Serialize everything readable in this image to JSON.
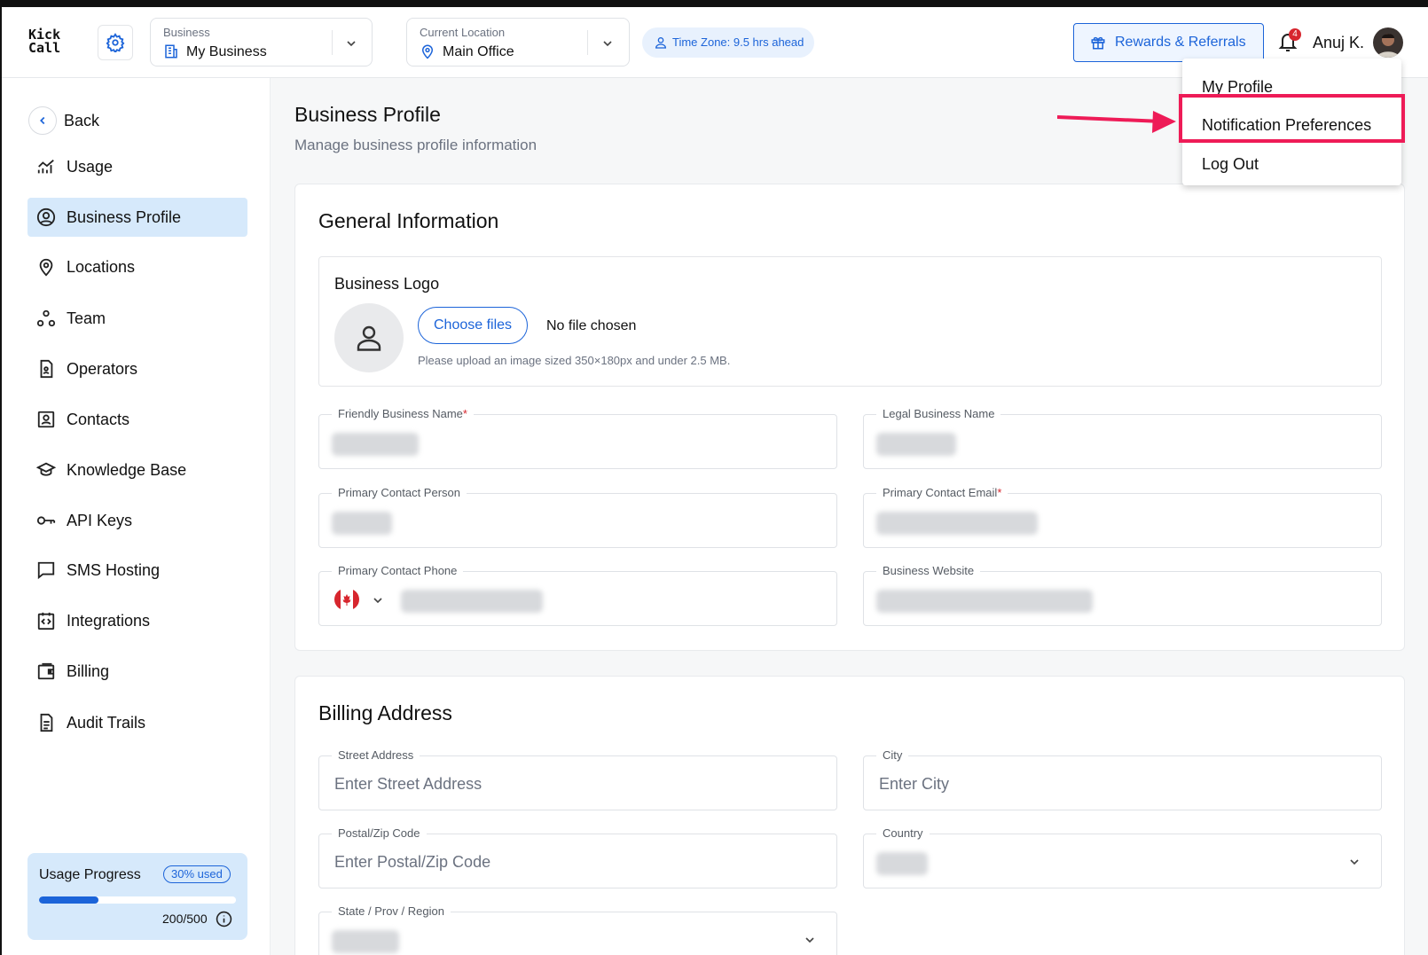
{
  "brand": {
    "logo_line1": "Kick",
    "logo_line2": "Call"
  },
  "header": {
    "business": {
      "caption": "Business",
      "value": "My Business"
    },
    "location": {
      "caption": "Current Location",
      "value": "Main Office"
    },
    "timezone": "Time Zone: 9.5 hrs ahead",
    "rewards": "Rewards & Referrals",
    "notification_count": "4",
    "user_name": "Anuj K."
  },
  "user_menu": {
    "items": [
      "My Profile",
      "Notification Preferences",
      "Log Out"
    ],
    "highlighted": "Notification Preferences",
    "highlight_color": "#ee1b57"
  },
  "sidebar": {
    "back": "Back",
    "items": [
      {
        "label": "Usage",
        "icon": "usage-chart-icon"
      },
      {
        "label": "Business Profile",
        "icon": "user-circle-icon",
        "active": true
      },
      {
        "label": "Locations",
        "icon": "map-pin-icon"
      },
      {
        "label": "Team",
        "icon": "team-icon"
      },
      {
        "label": "Operators",
        "icon": "operator-file-icon"
      },
      {
        "label": "Contacts",
        "icon": "contact-card-icon"
      },
      {
        "label": "Knowledge Base",
        "icon": "graduation-cap-icon"
      },
      {
        "label": "API Keys",
        "icon": "key-icon"
      },
      {
        "label": "SMS Hosting",
        "icon": "message-icon"
      },
      {
        "label": "Integrations",
        "icon": "code-icon"
      },
      {
        "label": "Billing",
        "icon": "wallet-icon"
      },
      {
        "label": "Audit Trails",
        "icon": "document-icon"
      }
    ],
    "usage": {
      "title": "Usage Progress",
      "pill": "30% used",
      "count": "200/500",
      "fraction": 0.3
    }
  },
  "page": {
    "title": "Business Profile",
    "subtitle": "Manage business profile information"
  },
  "general": {
    "title": "General Information",
    "logo_label": "Business Logo",
    "choose_files": "Choose files",
    "no_file": "No file chosen",
    "hint": "Please upload an image sized 350×180px and under 2.5 MB.",
    "fields": {
      "friendly_name": "Friendly Business Name",
      "legal_name": "Legal Business Name",
      "contact_person": "Primary Contact Person",
      "contact_email": "Primary Contact Email",
      "contact_phone": "Primary Contact Phone",
      "website": "Business Website"
    }
  },
  "billing": {
    "title": "Billing Address",
    "street": {
      "label": "Street Address",
      "placeholder": "Enter Street Address"
    },
    "city": {
      "label": "City",
      "placeholder": "Enter City"
    },
    "postal": {
      "label": "Postal/Zip Code",
      "placeholder": "Enter Postal/Zip Code"
    },
    "country": {
      "label": "Country"
    },
    "state": {
      "label": "State / Prov / Region"
    }
  },
  "colors": {
    "accent": "#1c64d9",
    "active_bg": "#d6e9fb",
    "required": "#d7262e"
  }
}
